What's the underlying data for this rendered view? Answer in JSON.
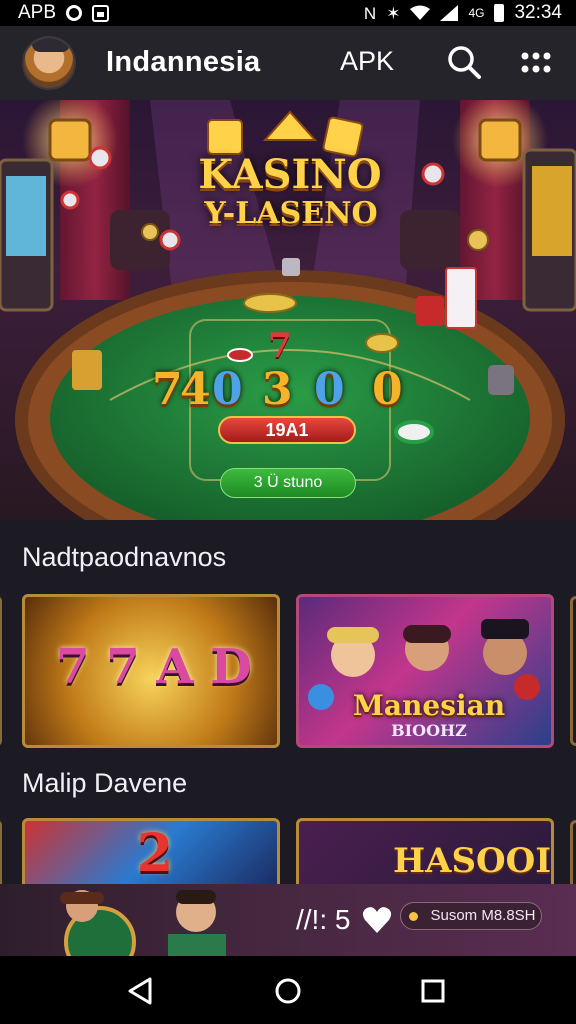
{
  "status_bar": {
    "carrier": "APB",
    "time": "32:34",
    "network_label": "4G",
    "icons": [
      "ring-icon",
      "app-box-icon",
      "nfc-icon",
      "bluetooth-icon",
      "wifi-icon",
      "signal-icon",
      "battery-icon"
    ]
  },
  "header": {
    "title": "Indannesia",
    "apk_label": "APK",
    "icons": [
      "avatar",
      "search-icon",
      "grid-menu-icon"
    ]
  },
  "hero": {
    "logo_line1": "KASINO",
    "logo_line2": "Y-LASENO",
    "numbers": [
      "7",
      "4",
      "0",
      "3",
      "0",
      "0"
    ],
    "red_number": "7",
    "jackpot": "19A1",
    "cta_label": "3 Ü stuno"
  },
  "sections": [
    {
      "title": "Nadtpaodnavnos",
      "cards": [
        {
          "label": "7 7 A D"
        },
        {
          "label_line1": "Manesian",
          "label_line2": "BIOOHZ"
        }
      ]
    },
    {
      "title": "Malip Davene",
      "cards": [
        {
          "label": "2"
        },
        {
          "label_line1": "HASOOI"
        }
      ]
    }
  ],
  "promo": {
    "count_text": "//!: 5",
    "pill_label": "Susom M8.8SH"
  },
  "colors": {
    "background": "#1c1a22",
    "header": "#26242b",
    "felt_green": "#1f7a36",
    "gold": "#ffd24a",
    "accent_green": "#2fa83a"
  },
  "nav": {
    "icons": [
      "back-icon",
      "home-icon",
      "recents-icon"
    ]
  }
}
